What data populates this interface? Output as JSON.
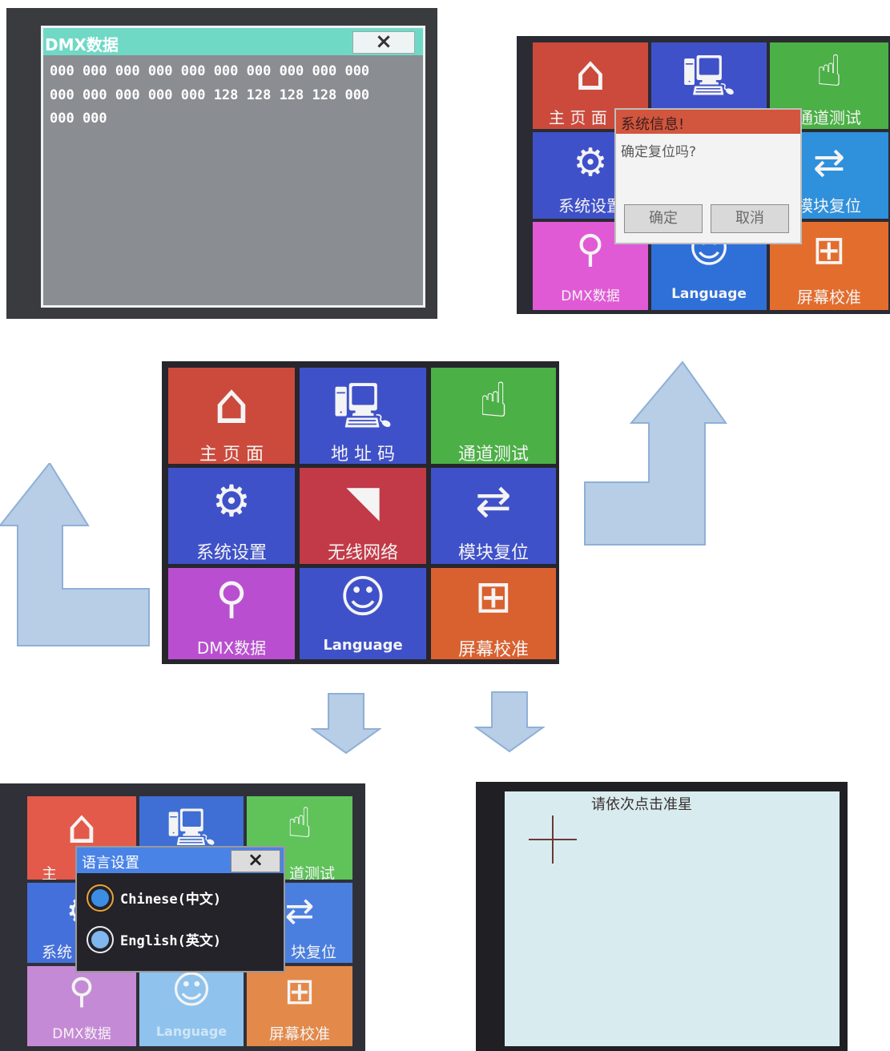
{
  "colors": {
    "red": "#cb4a3c",
    "blue": "#3f51c9",
    "green": "#4bb046",
    "crimson": "#c23a47",
    "purple": "#b94fd0",
    "orange": "#d9612f",
    "cyan_title": "#6fd9c6",
    "dialog_title": "#d2553d",
    "arrow_fill": "#b8cde6",
    "arrow_stroke": "#8fb0d6"
  },
  "tiles": [
    {
      "label": "主 页 面",
      "icon": "home-icon",
      "glyph": "⌂"
    },
    {
      "label": "地 址 码",
      "icon": "computer-network-icon",
      "glyph": "🖳"
    },
    {
      "label": "通道测试",
      "icon": "hand-pointer-icon",
      "glyph": "☝"
    },
    {
      "label": "系统设置",
      "icon": "gear-icon",
      "glyph": "⚙"
    },
    {
      "label": "无线网络",
      "icon": "wireless-icon",
      "glyph": "◥"
    },
    {
      "label": "模块复位",
      "icon": "refresh-arrows-icon",
      "glyph": "⇄"
    },
    {
      "label": "DMX数据",
      "icon": "search-icon",
      "glyph": "⚲"
    },
    {
      "label": "Language",
      "icon": "smiley-icon",
      "glyph": "☺"
    },
    {
      "label": "屏幕校准",
      "icon": "grid-icon",
      "glyph": "⊞"
    }
  ],
  "dmx_window": {
    "title": "DMX数据",
    "close": "×",
    "rows": [
      "000 000 000 000 000 000 000 000 000 000",
      "000 000 000 000 000 128 128 128 128 000",
      "000 000"
    ]
  },
  "reset_dialog": {
    "title": "系统信息!",
    "message": "确定复位吗?",
    "ok": "确定",
    "cancel": "取消",
    "bg_labels": [
      "主 页 面",
      "通道测试",
      "系统设置",
      "模块复位",
      "DMX数据",
      "Language",
      "屏幕校准"
    ]
  },
  "language_dialog": {
    "title": "语言设置",
    "close": "×",
    "options": [
      "Chinese(中文)",
      "English(英文)"
    ],
    "bg_labels": [
      "主",
      "道测试",
      "系统",
      "块复位",
      "DMX数据",
      "Language",
      "屏幕校准"
    ]
  },
  "calibration": {
    "prompt": "请依次点击准星"
  }
}
